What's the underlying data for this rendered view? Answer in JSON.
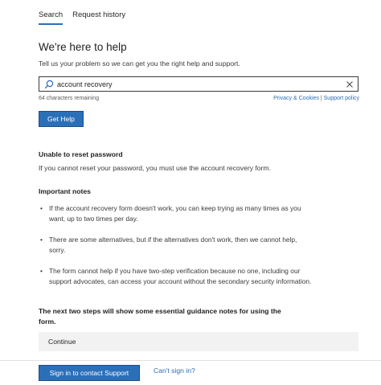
{
  "tabs": [
    {
      "label": "Search",
      "active": true
    },
    {
      "label": "Request history",
      "active": false
    }
  ],
  "header": {
    "title": "We're here to help",
    "subtitle": "Tell us your problem so we can get you the right help and support."
  },
  "search": {
    "value": "account recovery",
    "placeholder": "",
    "search_icon": "search-icon",
    "clear_icon": "close-icon",
    "remaining": "64 characters remaining"
  },
  "links": {
    "privacy": "Privacy & Cookies",
    "separator": "|",
    "support_policy": "Support policy"
  },
  "get_help_label": "Get Help",
  "result": {
    "heading": "Unable to reset password",
    "text": "If you cannot reset your password, you must use the account recovery form."
  },
  "notes": {
    "heading": "Important notes",
    "items": [
      "If the account recovery form doesn't work, you can keep trying as many times as you want, up to two times per day.",
      "There are some alternatives, but if the alternatives don't work, then we cannot help, sorry.",
      "The form cannot help if you have two-step verification because no one, including our support advocates, can access your account without the secondary security information."
    ]
  },
  "guidance": "The next two steps will show some essential guidance notes for using the form.",
  "continue_label": "Continue",
  "footer": {
    "signin_label": "Sign in to contact Support",
    "cant_signin": "Can't sign in?"
  },
  "colors": {
    "accent": "#2b6fb8",
    "continue_bg": "#f2f2f2"
  }
}
